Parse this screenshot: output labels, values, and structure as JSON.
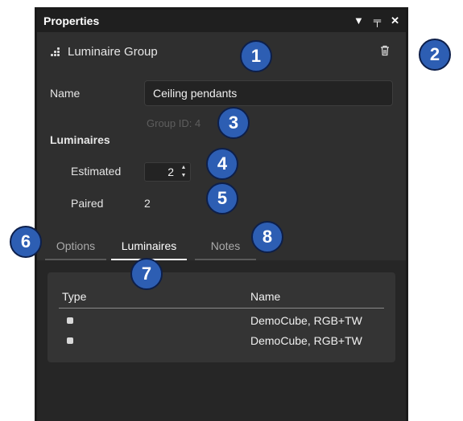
{
  "titlebar": {
    "title": "Properties",
    "icons": [
      "dropdown-triangle-icon",
      "pin-icon",
      "close-icon"
    ],
    "menu_glyph": "▼",
    "pin_glyph": "╤",
    "close_glyph": "✕"
  },
  "group": {
    "label": "Luminaire Group"
  },
  "name_field": {
    "label": "Name",
    "value": "Ceiling pendants"
  },
  "group_id": "Group ID: 4",
  "luminaires_section": {
    "title": "Luminaires",
    "estimated_label": "Estimated",
    "estimated_value": "2",
    "paired_label": "Paired",
    "paired_value": "2"
  },
  "tabs": [
    {
      "label": "Options",
      "active": false
    },
    {
      "label": "Luminaires",
      "active": true
    },
    {
      "label": "Notes",
      "active": false
    }
  ],
  "table": {
    "columns": [
      "Type",
      "Name"
    ],
    "rows": [
      {
        "type_icon": "cube-icon",
        "name": "DemoCube, RGB+TW"
      },
      {
        "type_icon": "cube-icon",
        "name": "DemoCube, RGB+TW"
      }
    ]
  },
  "callouts": [
    "1",
    "2",
    "3",
    "4",
    "5",
    "6",
    "7",
    "8"
  ],
  "colors": {
    "panel": "#2f2f2f",
    "titlebar": "#1f1f1f",
    "badge": "#2d5eb3",
    "content": "#262626"
  }
}
